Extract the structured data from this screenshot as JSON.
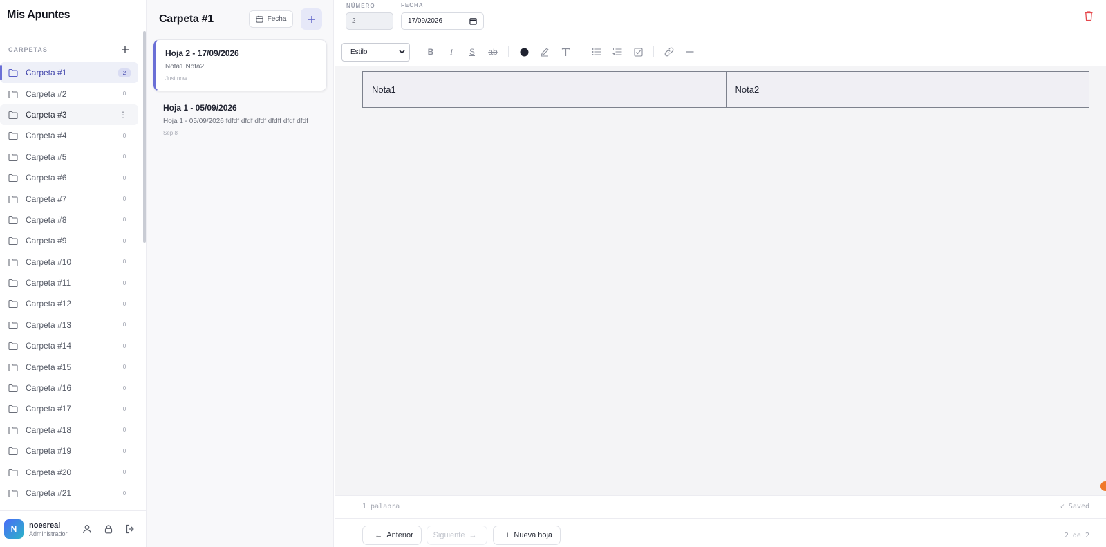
{
  "app": {
    "title": "Mis Apuntes"
  },
  "sidebar": {
    "section_label": "CARPETAS",
    "folders": [
      {
        "name": "Carpeta #1",
        "count": "2"
      },
      {
        "name": "Carpeta #2",
        "count": "0"
      },
      {
        "name": "Carpeta #3",
        "count": ""
      },
      {
        "name": "Carpeta #4",
        "count": "0"
      },
      {
        "name": "Carpeta #5",
        "count": "0"
      },
      {
        "name": "Carpeta #6",
        "count": "0"
      },
      {
        "name": "Carpeta #7",
        "count": "0"
      },
      {
        "name": "Carpeta #8",
        "count": "0"
      },
      {
        "name": "Carpeta #9",
        "count": "0"
      },
      {
        "name": "Carpeta #10",
        "count": "0"
      },
      {
        "name": "Carpeta #11",
        "count": "0"
      },
      {
        "name": "Carpeta #12",
        "count": "0"
      },
      {
        "name": "Carpeta #13",
        "count": "0"
      },
      {
        "name": "Carpeta #14",
        "count": "0"
      },
      {
        "name": "Carpeta #15",
        "count": "0"
      },
      {
        "name": "Carpeta #16",
        "count": "0"
      },
      {
        "name": "Carpeta #17",
        "count": "0"
      },
      {
        "name": "Carpeta #18",
        "count": "0"
      },
      {
        "name": "Carpeta #19",
        "count": "0"
      },
      {
        "name": "Carpeta #20",
        "count": "0"
      },
      {
        "name": "Carpeta #21",
        "count": "0"
      }
    ],
    "user": {
      "initial": "N",
      "name": "noesreal",
      "role": "Administrador"
    }
  },
  "notes": {
    "folder_title": "Carpeta #1",
    "sort_label": "Fecha",
    "items": [
      {
        "title": "Hoja 2 - 17/09/2026",
        "snippet": "Nota1 Nota2",
        "time": "Just now"
      },
      {
        "title": "Hoja 1 - 05/09/2026",
        "snippet": "Hoja 1 - 05/09/2026 fdfdf dfdf dfdf dfdff dfdf dfdf",
        "time": "Sep 8"
      }
    ]
  },
  "editor": {
    "number_label": "NÚMERO",
    "number_value": "2",
    "date_label": "FECHA",
    "date_value": "17/09/2026",
    "style_select": "Estilo",
    "table": [
      "Nota1",
      "Nota2"
    ],
    "word_count": "1 palabra",
    "saved_status": "✓ Saved",
    "prev_label": "Anterior",
    "next_label": "Siguiente",
    "new_label": "Nueva hoja",
    "pager": "2 de 2",
    "colors": {
      "accent": "#6a6fd6",
      "danger": "#e5484d",
      "text_swatch": "#1f2230"
    }
  }
}
